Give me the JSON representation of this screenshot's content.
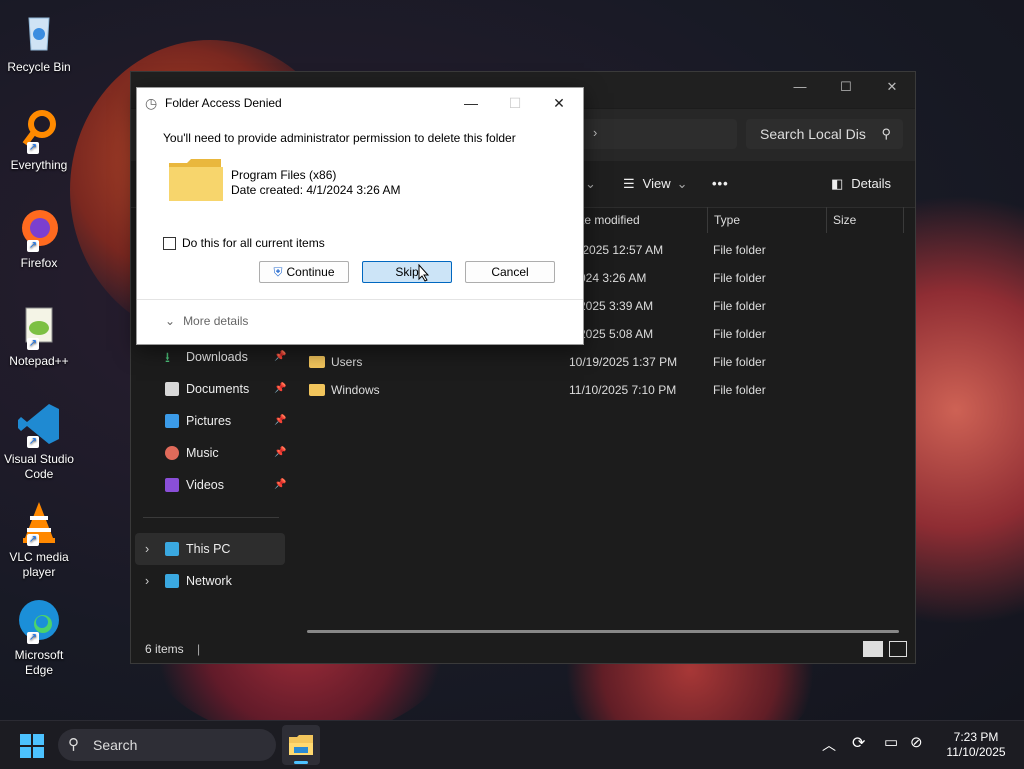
{
  "desktop": {
    "icons": [
      {
        "label": "Recycle Bin"
      },
      {
        "label": "Everything"
      },
      {
        "label": "Firefox"
      },
      {
        "label": "Notepad++"
      },
      {
        "label": "Visual Studio Code"
      },
      {
        "label": "VLC media player"
      },
      {
        "label": "Microsoft Edge"
      }
    ]
  },
  "explorer": {
    "search_placeholder": "Search Local Dis",
    "toolbar": {
      "view": "View",
      "more": "•••",
      "details": "Details"
    },
    "columns": {
      "modified": "te modified",
      "type": "Type",
      "size": "Size"
    },
    "rows": [
      {
        "name": "",
        "modified": "/9/2025 12:57 AM",
        "type": "File folder"
      },
      {
        "name": "",
        "modified": "/2024 3:26 AM",
        "type": "File folder"
      },
      {
        "name": "",
        "modified": "1/2025 3:39 AM",
        "type": "File folder"
      },
      {
        "name": "",
        "modified": "4/2025 5:08 AM",
        "type": "File folder"
      },
      {
        "name": "Users",
        "modified": "10/19/2025 1:37 PM",
        "type": "File folder"
      },
      {
        "name": "Windows",
        "modified": "11/10/2025 7:10 PM",
        "type": "File folder"
      }
    ],
    "nav": [
      {
        "label": "Downloads"
      },
      {
        "label": "Documents"
      },
      {
        "label": "Pictures"
      },
      {
        "label": "Music"
      },
      {
        "label": "Videos"
      },
      {
        "label": "This PC"
      },
      {
        "label": "Network"
      }
    ],
    "status": "6 items"
  },
  "dialog": {
    "title": "Folder Access Denied",
    "message": "You'll need to provide administrator permission to delete this folder",
    "item_name": "Program Files (x86)",
    "item_date": "Date created: 4/1/2024 3:26 AM",
    "checkbox_label": "Do this for all current items",
    "continue": "Continue",
    "skip": "Skip",
    "cancel": "Cancel",
    "more_details": "More details"
  },
  "taskbar": {
    "search": "Search",
    "time": "7:23 PM",
    "date": "11/10/2025"
  },
  "colors": {
    "accent": "#0067c0",
    "folder": "#f2c55c"
  }
}
